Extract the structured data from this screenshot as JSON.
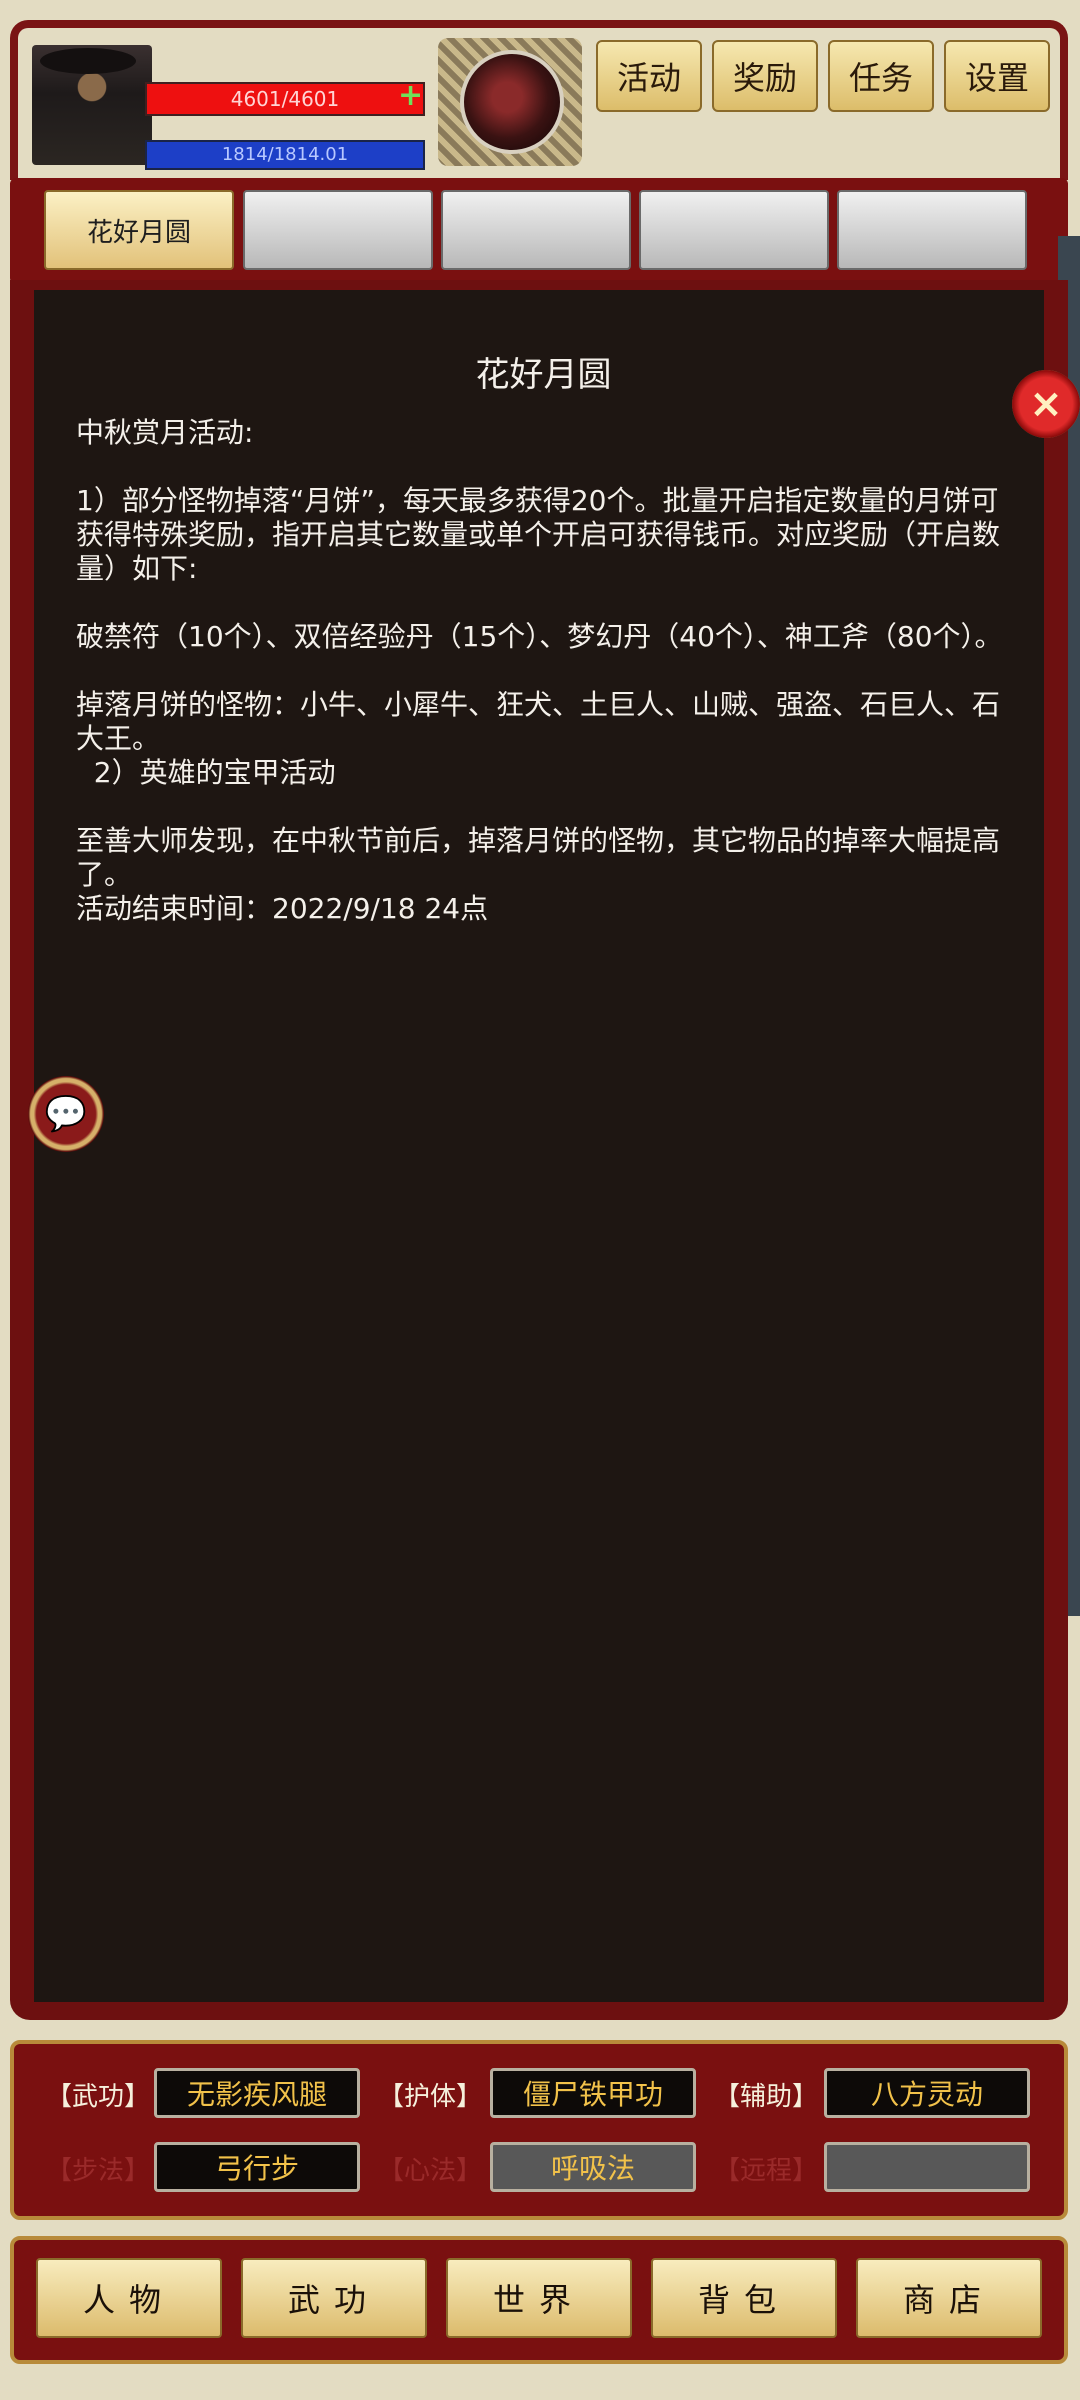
{
  "header": {
    "player_name": "",
    "hp_text": "4601/4601",
    "hp_plus": "+",
    "mp_text": "1814/1814.01",
    "top_buttons": [
      "活动",
      "奖励",
      "任务",
      "设置"
    ]
  },
  "tabs": [
    {
      "label": "花好月圆",
      "active": true
    },
    {
      "label": ""
    },
    {
      "label": ""
    },
    {
      "label": ""
    },
    {
      "label": ""
    }
  ],
  "content": {
    "title": "花好月圆",
    "lines": [
      "中秋赏月活动:",
      "1）部分怪物掉落“月饼”，每天最多获得20个。批量开启指定数量的月饼可获得特殊奖励，指开启其它数量或单个开启可获得钱币。对应奖励（开启数量）如下:",
      "破禁符（10个）、双倍经验丹（15个）、梦幻丹（40个）、神工斧（80个）。",
      "掉落月饼的怪物：小牛、小犀牛、狂犬、土巨人、山贼、强盗、石巨人、石大王。",
      "  2）英雄的宝甲活动",
      "至善大师发现，在中秋节前后，掉落月饼的怪物，其它物品的掉率大幅提高了。",
      "活动结束时间：2022/9/18 24点"
    ]
  },
  "icons": {
    "close": "×",
    "chat": "💬"
  },
  "skills": {
    "row1": [
      {
        "label": "【武功】",
        "value": "无影疾风腿"
      },
      {
        "label": "【护体】",
        "value": "僵尸铁甲功"
      },
      {
        "label": "【辅助】",
        "value": "八方灵动"
      }
    ],
    "row2": [
      {
        "label": "【步法】",
        "value": "弓行步"
      },
      {
        "label": "【心法】",
        "value": "呼吸法"
      },
      {
        "label": "【远程】",
        "value": ""
      }
    ]
  },
  "nav": [
    "人物",
    "武功",
    "世界",
    "背包",
    "商店"
  ]
}
